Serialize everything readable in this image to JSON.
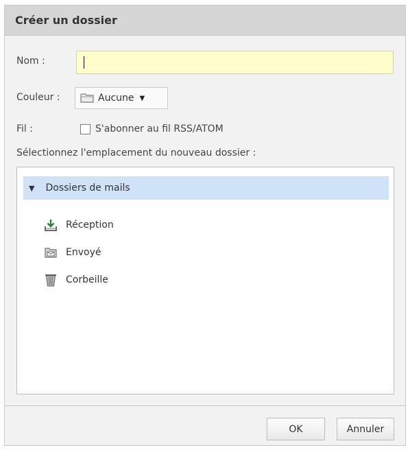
{
  "dialog": {
    "title": "Créer un dossier"
  },
  "form": {
    "name_label": "Nom :",
    "name_value": "",
    "color_label": "Couleur :",
    "color_value": "Aucune",
    "feed_label": "Fil :",
    "feed_checkbox_label": "S'abonner au fil RSS/ATOM",
    "feed_checked": false,
    "location_label": "Sélectionnez l'emplacement du nouveau dossier :"
  },
  "tree": {
    "root": {
      "label": "Dossiers de mails",
      "expanded": true,
      "selected": true
    },
    "items": [
      {
        "label": "Réception",
        "icon": "inbox-download-icon"
      },
      {
        "label": "Envoyé",
        "icon": "sent-folder-icon"
      },
      {
        "label": "Corbeille",
        "icon": "trash-icon"
      }
    ]
  },
  "buttons": {
    "ok": "OK",
    "cancel": "Annuler"
  },
  "colors": {
    "input_bg": "#ffffcc",
    "selection_bg": "#cfe2f7",
    "titlebar_bg": "#d6d6d6",
    "dialog_bg": "#f2f2f2"
  }
}
